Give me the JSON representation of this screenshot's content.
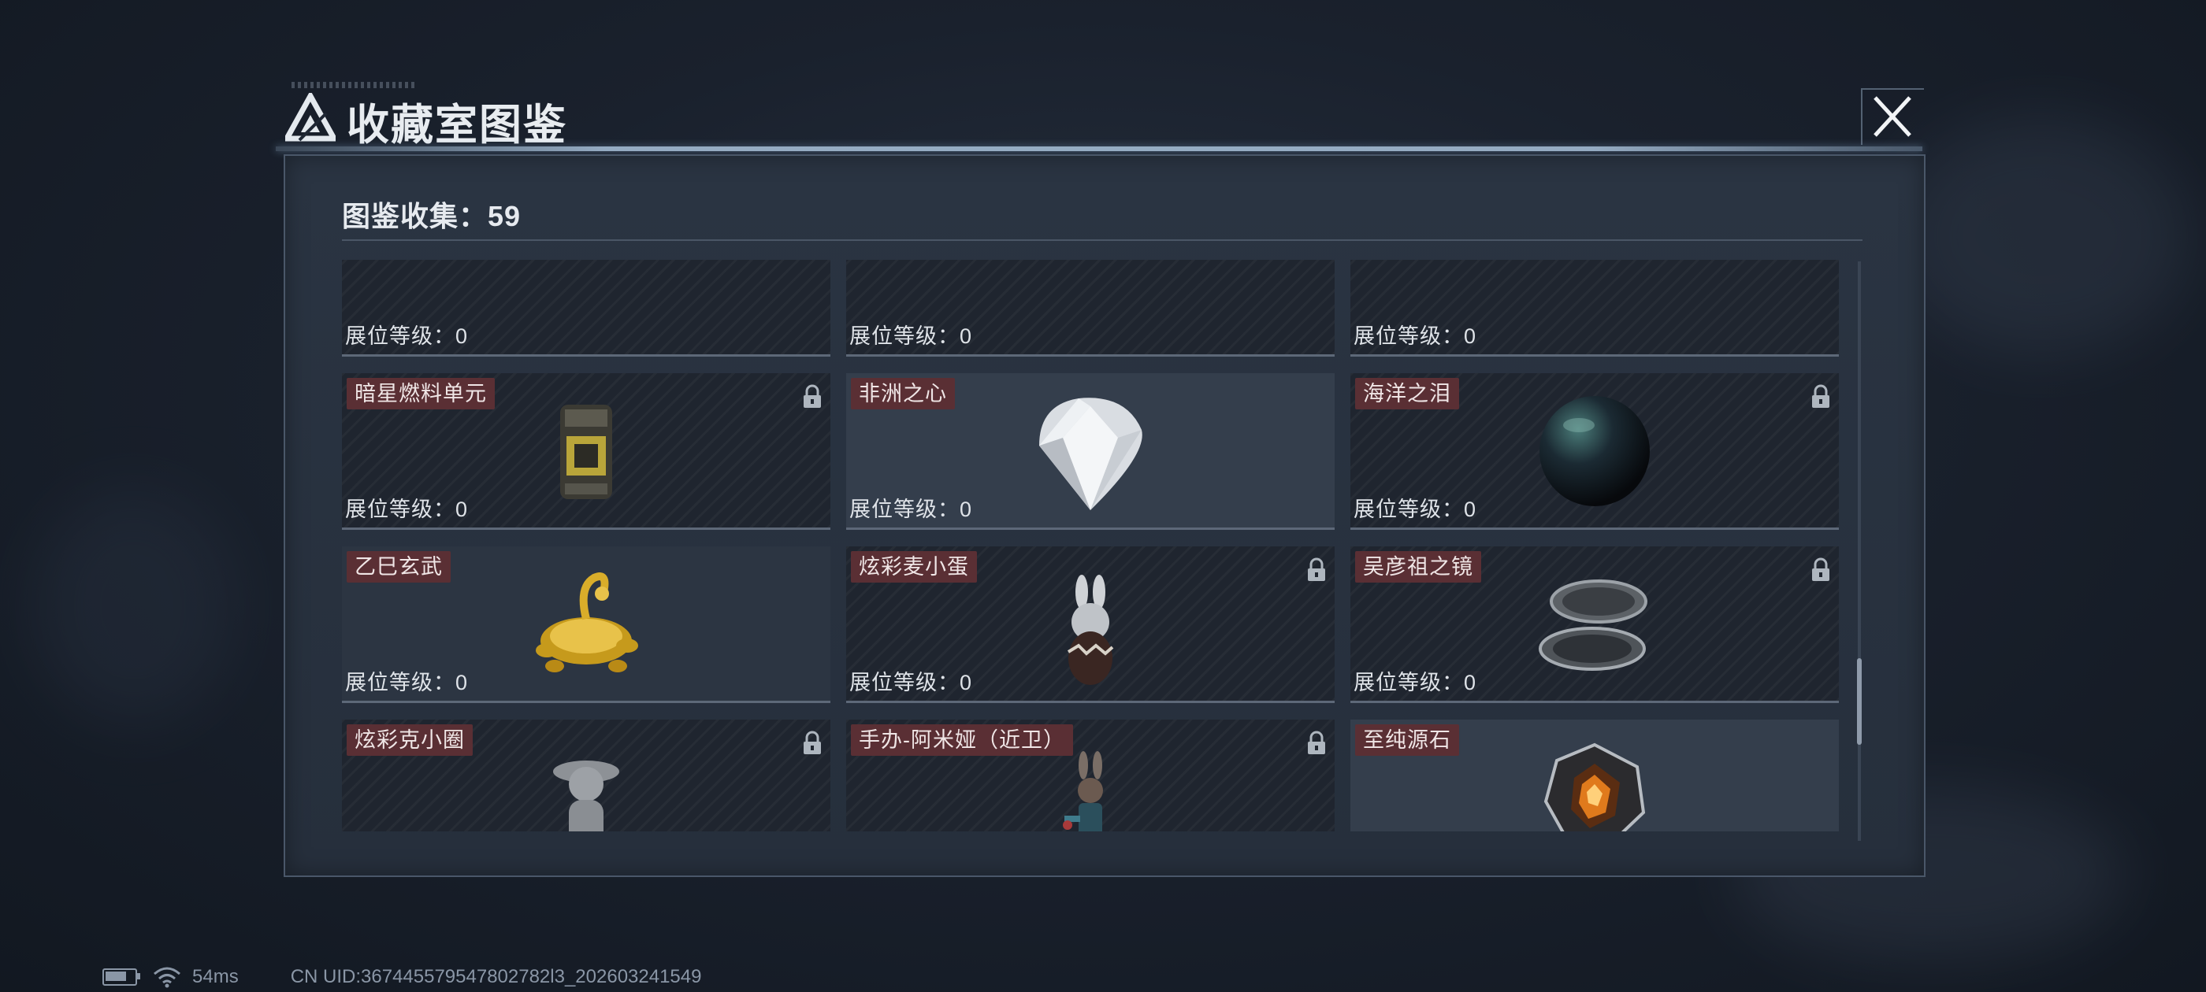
{
  "header": {
    "title": "收藏室图鉴",
    "close_icon": "close-icon"
  },
  "collection": {
    "label": "图鉴收集：59"
  },
  "level_label": "展位等级：0",
  "items": [
    {
      "name": "",
      "locked": false,
      "icon": "partial-item-icon"
    },
    {
      "name": "",
      "locked": false,
      "icon": "ring-icon"
    },
    {
      "name": "",
      "locked": false,
      "icon": "device-icon"
    },
    {
      "name": "暗星燃料单元",
      "locked": true,
      "icon": "fuel-cell-icon"
    },
    {
      "name": "非洲之心",
      "locked": false,
      "icon": "diamond-icon"
    },
    {
      "name": "海洋之泪",
      "locked": true,
      "icon": "black-pearl-icon"
    },
    {
      "name": "乙巳玄武",
      "locked": false,
      "icon": "golden-turtle-snake-icon"
    },
    {
      "name": "炫彩麦小蛋",
      "locked": true,
      "icon": "bunny-egg-figure-icon"
    },
    {
      "name": "吴彦祖之镜",
      "locked": true,
      "icon": "compact-mirror-icon"
    },
    {
      "name": "炫彩克小圈",
      "locked": true,
      "icon": "cat-figure-icon"
    },
    {
      "name": "手办-阿米娅（近卫）",
      "locked": true,
      "icon": "amiya-figure-icon"
    },
    {
      "name": "至纯源石",
      "locked": false,
      "icon": "originium-crystal-icon"
    }
  ],
  "status_bar": {
    "ping": "54ms",
    "uid": "CN UID:367445579547802782l3_202603241549"
  },
  "colors": {
    "name_tag_bg": "#5a2f34",
    "panel_bg": "#2a3442",
    "accent_line": "#aac3dc"
  }
}
